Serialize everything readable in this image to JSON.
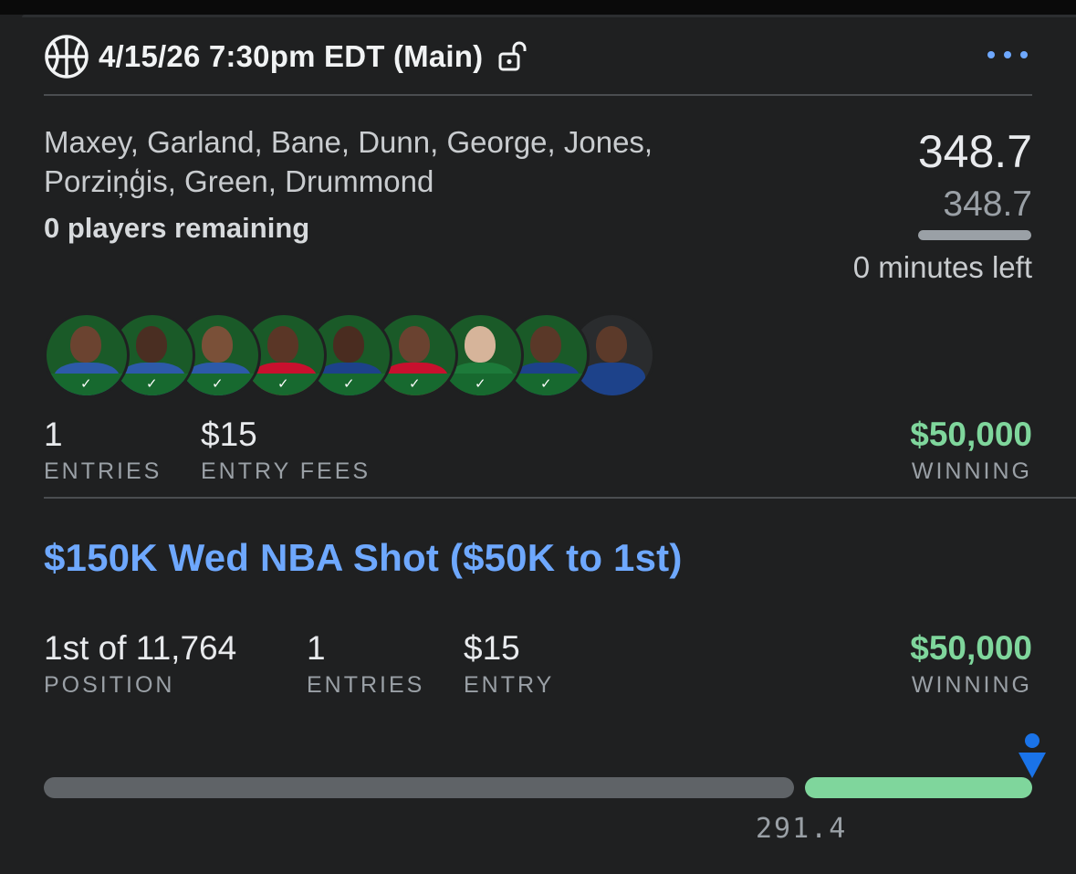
{
  "header": {
    "title": "4/15/26 7:30pm EDT (Main)",
    "sport_icon": "basketball-icon",
    "lock_icon": "unlock-icon",
    "more_icon": "more-horizontal-icon"
  },
  "lineup": {
    "players_line1": "Maxey, Garland, Bane, Dunn, George, Jones,",
    "players_line2": "Porziņģis, Green, Drummond",
    "remaining": "0 players remaining",
    "score": "348.7",
    "projected": "348.7",
    "minutes_left": "0 minutes left",
    "avatars": [
      {
        "player": "Maxey",
        "checked": true
      },
      {
        "player": "Garland",
        "checked": true
      },
      {
        "player": "Bane",
        "checked": true
      },
      {
        "player": "Dunn",
        "checked": true
      },
      {
        "player": "George",
        "checked": true
      },
      {
        "player": "Jones",
        "checked": true
      },
      {
        "player": "Porziņģis",
        "checked": true
      },
      {
        "player": "Green",
        "checked": true
      },
      {
        "player": "Drummond",
        "checked": false
      }
    ]
  },
  "summary": {
    "entries_value": "1",
    "entries_label": "ENTRIES",
    "fees_value": "$15",
    "fees_label": "ENTRY FEES",
    "winning_value": "$50,000",
    "winning_label": "WINNING"
  },
  "contest": {
    "name": "$150K Wed NBA Shot ($50K to 1st)",
    "position_value": "1st of 11,764",
    "position_label": "POSITION",
    "entries_value": "1",
    "entries_label": "ENTRIES",
    "entry_value": "$15",
    "entry_label": "ENTRY",
    "winning_value": "$50,000",
    "winning_label": "WINNING",
    "cutoff_score": "291.4",
    "progress_fraction": 1.0
  },
  "colors": {
    "accent_blue": "#6ea8fe",
    "money_green": "#7fd69c",
    "background": "#1f2021"
  }
}
